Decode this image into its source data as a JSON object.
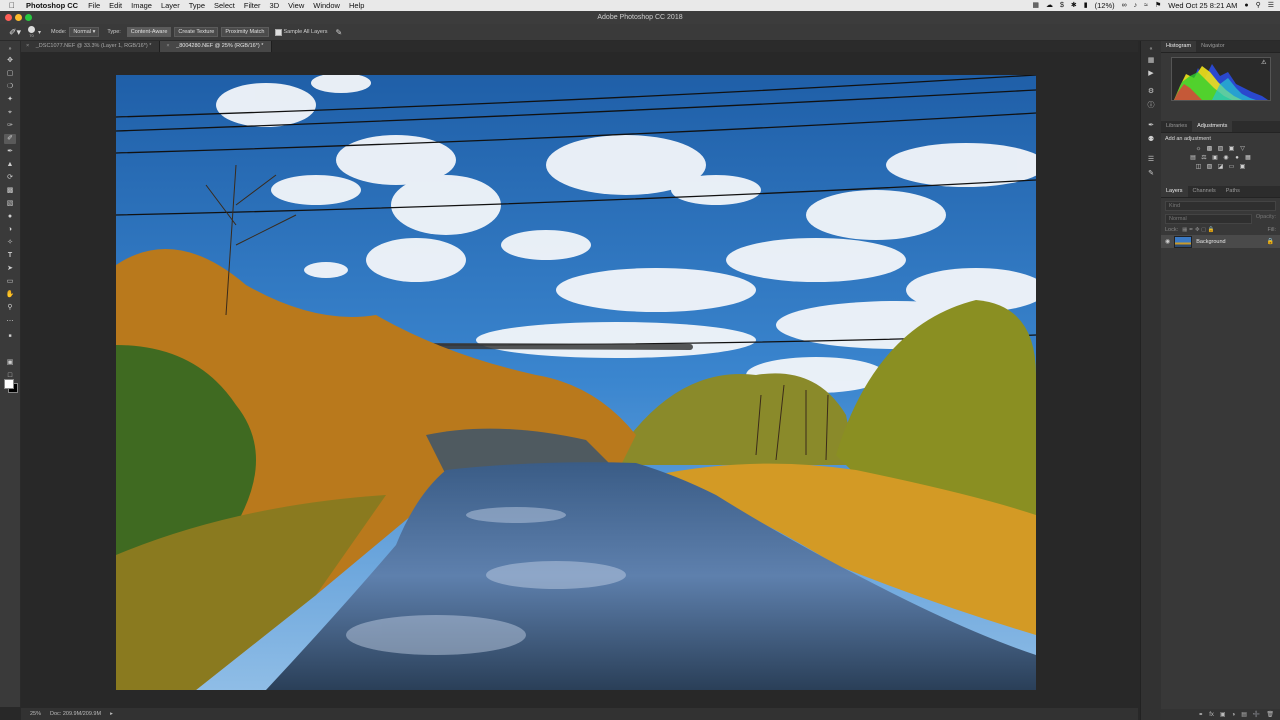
{
  "menubar": {
    "app": "Photoshop CC",
    "items": [
      "File",
      "Edit",
      "Image",
      "Layer",
      "Type",
      "Select",
      "Filter",
      "3D",
      "View",
      "Window",
      "Help"
    ],
    "battery": "(12%)",
    "datetime": "Wed Oct 25  8:21 AM"
  },
  "appbar": {
    "title": "Adobe Photoshop CC 2018"
  },
  "options": {
    "brush_size": "70",
    "mode_label": "Mode:",
    "mode_value": "Normal",
    "type_label": "Type:",
    "type_buttons": [
      "Content-Aware",
      "Create Texture",
      "Proximity Match"
    ],
    "sample_all_layers": "Sample All Layers"
  },
  "tabs": [
    {
      "label": "_DSC1077.NEF @ 33.3% (Layer 1, RGB/16*) *",
      "active": false
    },
    {
      "label": "_8004280.NEF @ 25% (RGB/16*) *",
      "active": true
    }
  ],
  "status": {
    "zoom": "25%",
    "doc": "Doc: 209.9M/209.9M"
  },
  "panels": {
    "histogram_tabs": [
      "Histogram",
      "Navigator"
    ],
    "adjust_tabs": [
      "Libraries",
      "Adjustments"
    ],
    "add_adjustment": "Add an adjustment",
    "layers_tabs": [
      "Layers",
      "Channels",
      "Paths"
    ],
    "kind_placeholder": "Kind",
    "blend_mode": "Normal",
    "opacity_label": "Opacity:",
    "lock_label": "Lock:",
    "fill_label": "Fill:",
    "layer_name": "Background"
  },
  "colors": {
    "foreground": "#ffffff",
    "background": "#000000",
    "sky": "#2d6fb8"
  }
}
